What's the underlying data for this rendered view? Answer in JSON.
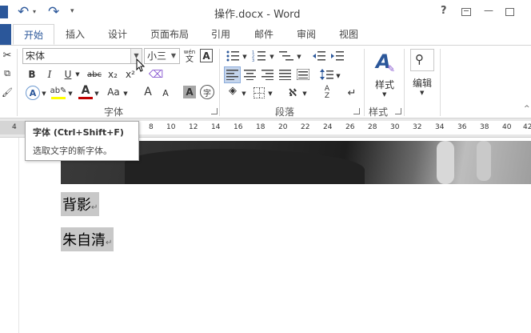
{
  "window": {
    "title": "操作.docx - Word",
    "help": "?",
    "minimize": "—"
  },
  "qat": {
    "undo": "↶",
    "redo": "↷",
    "customize": "▾"
  },
  "tabs": [
    {
      "label": "开始",
      "active": true
    },
    {
      "label": "插入"
    },
    {
      "label": "设计"
    },
    {
      "label": "页面布局"
    },
    {
      "label": "引用"
    },
    {
      "label": "邮件"
    },
    {
      "label": "审阅"
    },
    {
      "label": "视图"
    }
  ],
  "font_group": {
    "label": "字体",
    "font_name": "宋体",
    "font_size": "小三",
    "bold": "B",
    "italic": "I",
    "underline": "U",
    "strike": "abc",
    "subscript": "x₂",
    "superscript": "x²",
    "phonetic_top": "wén",
    "phonetic_bottom": "文",
    "border_char": "A",
    "grow": "A",
    "shrink": "A",
    "change_case": "Aa",
    "char_shading": "A",
    "enclose": "字"
  },
  "paragraph_group": {
    "label": "段落"
  },
  "styles_group": {
    "label": "样式",
    "button": "样式"
  },
  "editing_group": {
    "button": "编辑"
  },
  "tooltip": {
    "title": "字体 (Ctrl+Shift+F)",
    "desc": "选取文字的新字体。"
  },
  "ruler": {
    "ticks": [
      "4",
      "8",
      "10",
      "12",
      "14",
      "16",
      "18",
      "20",
      "22",
      "24",
      "26",
      "28",
      "30",
      "32",
      "34",
      "36",
      "38",
      "40",
      "42"
    ]
  },
  "document": {
    "lines": [
      "背影",
      "朱自清"
    ],
    "para_mark": "↵"
  },
  "colors": {
    "accent": "#2b579a",
    "font_color": "#c00000",
    "highlight": "#ffff00"
  }
}
